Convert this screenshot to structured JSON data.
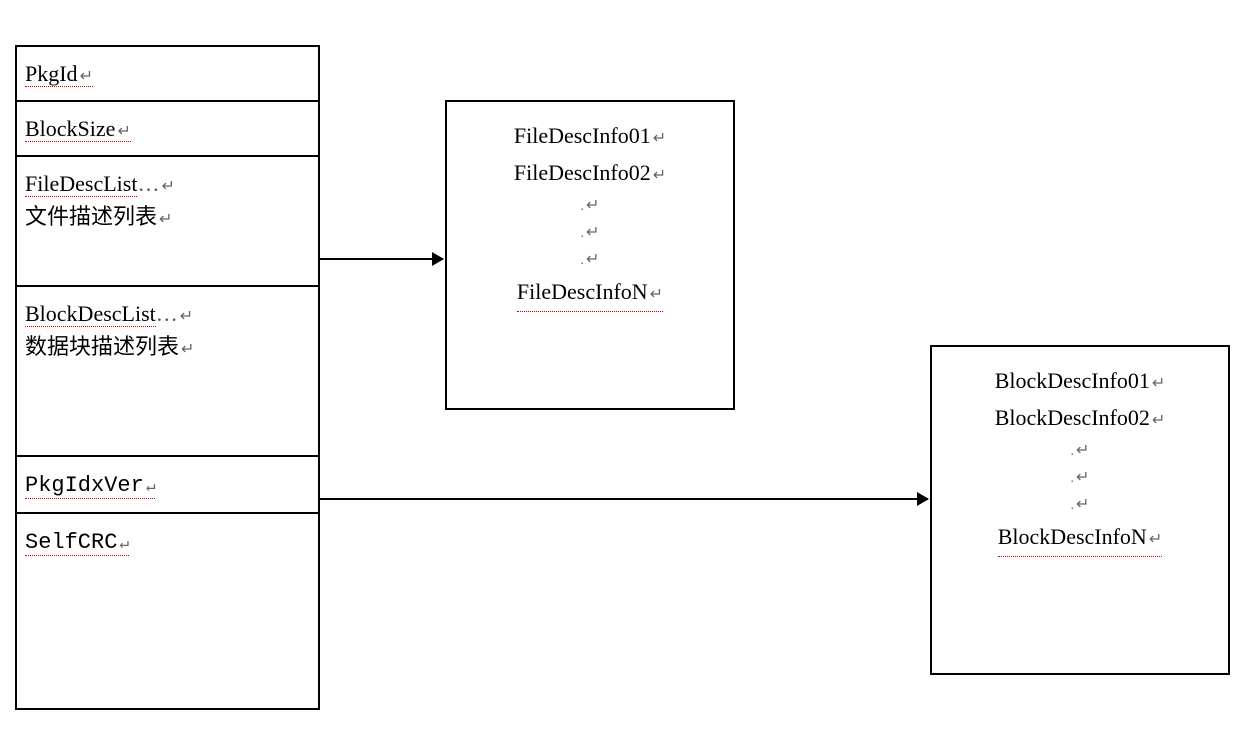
{
  "main": {
    "rows": {
      "r1": "PkgId",
      "r2": "BlockSize",
      "r3a": "FileDescList",
      "r3b": "文件描述列表",
      "r4a": "BlockDescList",
      "r4b": "数据块描述列表",
      "r5": "PkgIdxVer",
      "r6": "SelfCRC"
    }
  },
  "fileBox": {
    "items": [
      "FileDescInfo01",
      "FileDescInfo02",
      "FileDescInfoN"
    ]
  },
  "blockBox": {
    "items": [
      "BlockDescInfo01",
      "BlockDescInfo02",
      "BlockDescInfoN"
    ]
  }
}
